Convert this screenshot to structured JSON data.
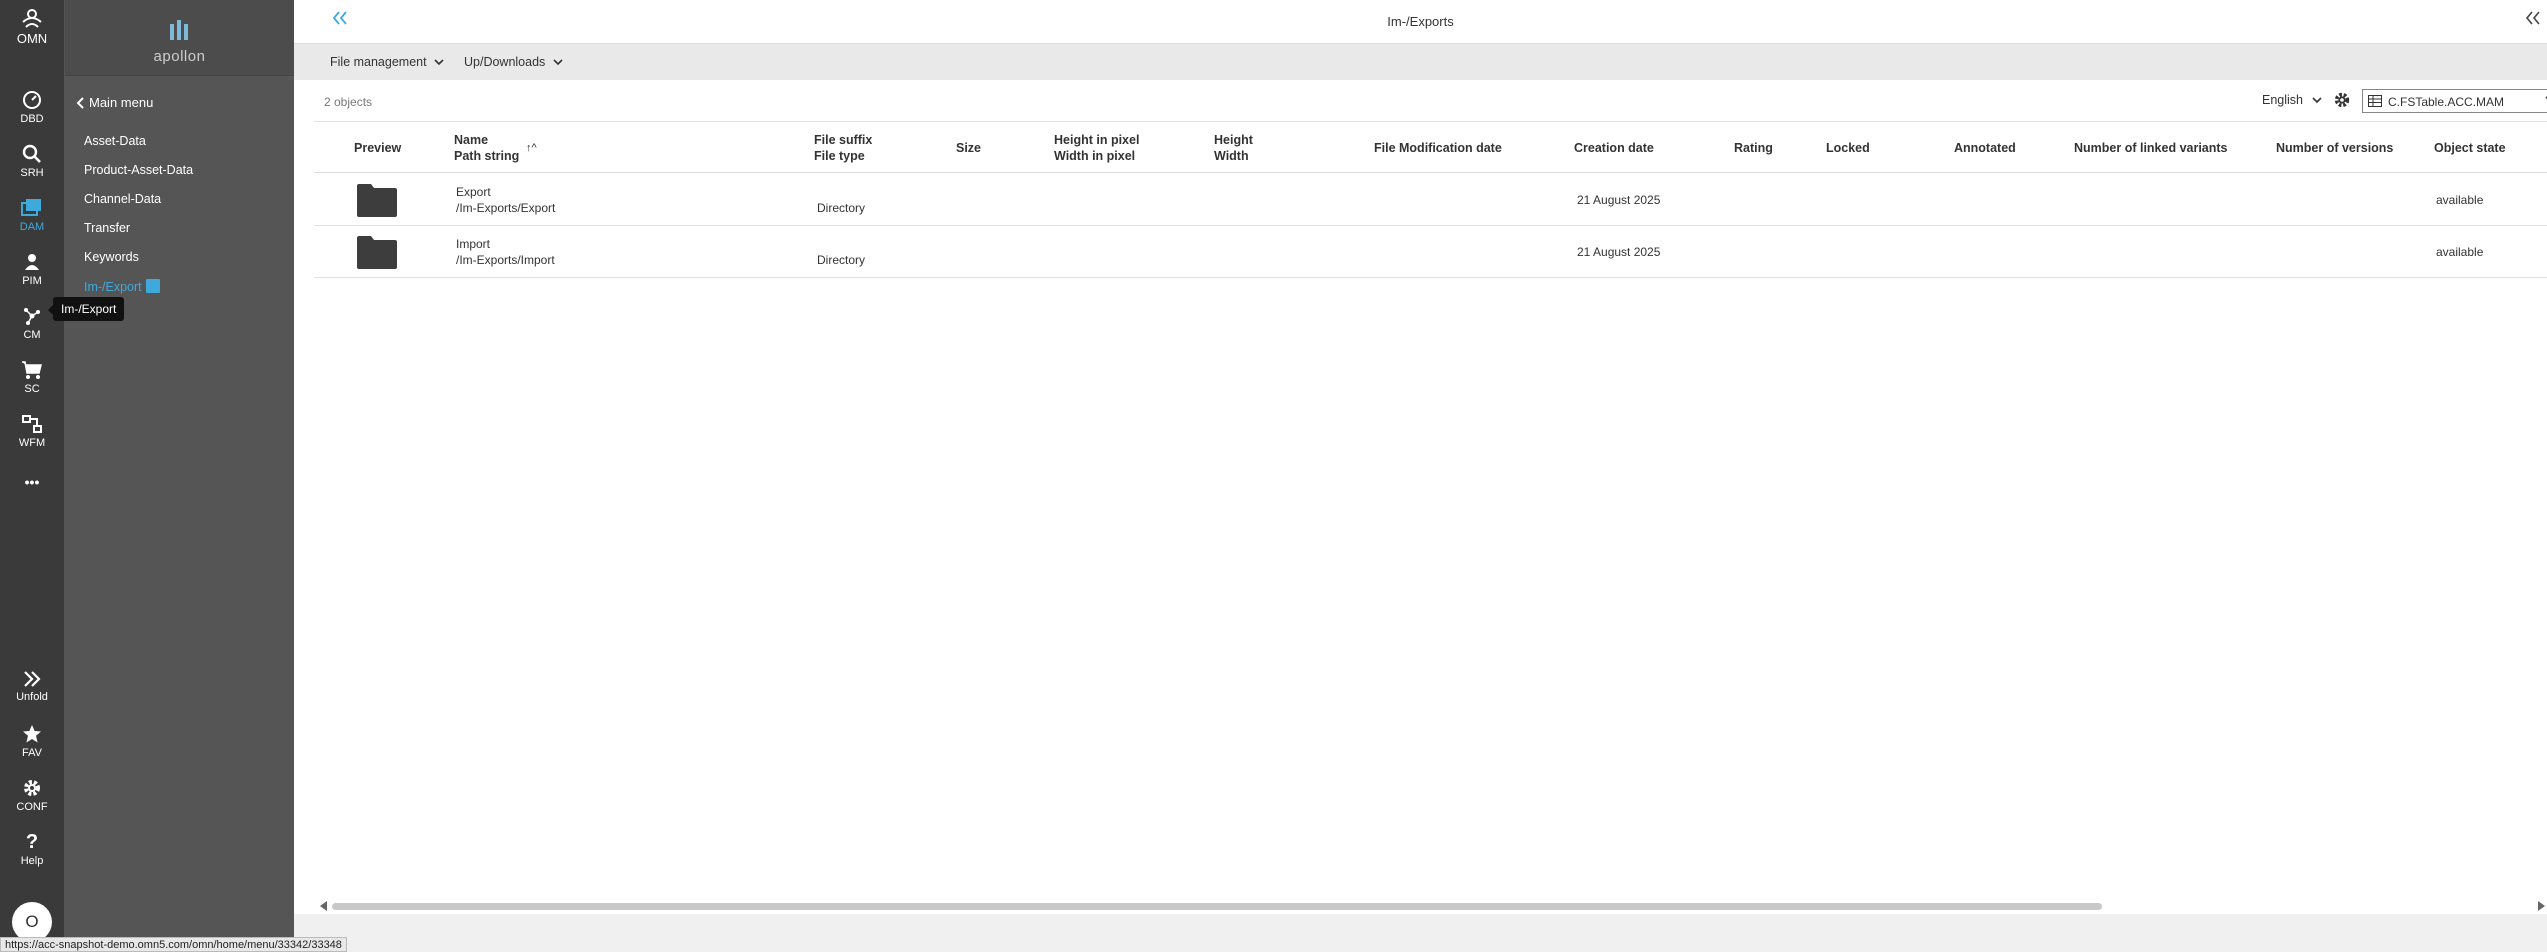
{
  "rail": {
    "logo_label": "OMN",
    "items": [
      {
        "label": "DBD",
        "icon": "dashboard-icon"
      },
      {
        "label": "SRH",
        "icon": "search-icon"
      },
      {
        "label": "DAM",
        "icon": "dam-icon"
      },
      {
        "label": "PIM",
        "icon": "pim-icon"
      },
      {
        "label": "CM",
        "icon": "cm-icon"
      },
      {
        "label": "SC",
        "icon": "cart-icon"
      },
      {
        "label": "WFM",
        "icon": "workflow-icon"
      }
    ],
    "more_label": "•••",
    "bottom": [
      {
        "label": "Unfold",
        "icon": "unfold-icon"
      },
      {
        "label": "FAV",
        "icon": "star-icon"
      },
      {
        "label": "CONF",
        "icon": "gear-icon"
      },
      {
        "label": "Help",
        "icon": "help-icon"
      }
    ],
    "avatar_initial": "O",
    "active_color": "#3fa9dc"
  },
  "tooltip": "Im-/Export",
  "menu": {
    "brand": "apollon",
    "main_menu_label": "Main menu",
    "items": [
      "Asset-Data",
      "Product-Asset-Data",
      "Channel-Data",
      "Transfer",
      "Keywords",
      "Im-/Export"
    ],
    "active_index": 5
  },
  "topbar": {
    "title": "Im-/Exports"
  },
  "toolbar": {
    "file_management": "File management",
    "up_downloads": "Up/Downloads"
  },
  "objbar": {
    "count": "2 objects",
    "language": "English",
    "table_config": "C.FSTable.ACC.MAM"
  },
  "table": {
    "headers": {
      "preview": "Preview",
      "name": "Name",
      "path": "Path string",
      "sort": "↑^",
      "suffix": "File suffix",
      "ftype": "File type",
      "size": "Size",
      "hpx": "Height in pixel",
      "wpx": "Width in pixel",
      "height": "Height",
      "width": "Width",
      "fmod": "File Modification date",
      "created": "Creation date",
      "rating": "Rating",
      "locked": "Locked",
      "annotated": "Annotated",
      "linked": "Number of linked variants",
      "versions": "Number of versions",
      "state": "Object state"
    },
    "rows": [
      {
        "name": "Export",
        "path": "/Im-Exports/Export",
        "ftype": "Directory",
        "created": "21 August 2025",
        "state": "available"
      },
      {
        "name": "Import",
        "path": "/Im-Exports/Import",
        "ftype": "Directory",
        "created": "21 August 2025",
        "state": "available"
      }
    ]
  },
  "status_url": "https://acc-snapshot-demo.omn5.com/omn/home/menu/33342/33348"
}
